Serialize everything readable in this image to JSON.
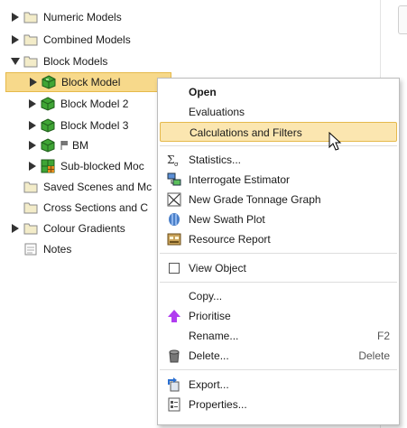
{
  "tree": {
    "items": [
      {
        "label": "Numeric Models",
        "icon": "folder-icon",
        "expanded": false,
        "has_arrow": true
      },
      {
        "label": "Combined Models",
        "icon": "folder-icon",
        "expanded": false,
        "has_arrow": true
      },
      {
        "label": "Block Models",
        "icon": "folder-icon",
        "expanded": true,
        "has_arrow": true
      },
      {
        "label": "Block Model",
        "icon": "block-model-icon",
        "expanded": false,
        "has_arrow": true,
        "selected": true
      },
      {
        "label": "Block Model 2",
        "icon": "block-model-icon",
        "expanded": false,
        "has_arrow": true
      },
      {
        "label": "Block Model 3",
        "icon": "block-model-icon",
        "expanded": false,
        "has_arrow": true
      },
      {
        "label": "BM",
        "icon": "block-model-flag-icon",
        "expanded": false,
        "has_arrow": true
      },
      {
        "label": "Sub-blocked Moc",
        "icon": "sub-blocked-model-icon",
        "expanded": false,
        "has_arrow": true
      },
      {
        "label": "Saved Scenes and Mc",
        "icon": "folder-icon",
        "has_arrow": false
      },
      {
        "label": "Cross Sections and C",
        "icon": "folder-icon",
        "has_arrow": false
      },
      {
        "label": "Colour Gradients",
        "icon": "folder-icon",
        "expanded": false,
        "has_arrow": true
      },
      {
        "label": "Notes",
        "icon": "notes-icon",
        "has_arrow": false
      }
    ]
  },
  "context_menu": {
    "items": [
      {
        "label": "Open",
        "bold": true
      },
      {
        "label": "Evaluations"
      },
      {
        "label": "Calculations and Filters",
        "hover": true
      },
      {
        "label": "Statistics...",
        "icon": "statistics-icon"
      },
      {
        "label": "Interrogate Estimator",
        "icon": "interrogate-icon"
      },
      {
        "label": "New Grade Tonnage Graph",
        "icon": "graph-icon"
      },
      {
        "label": "New Swath Plot",
        "icon": "swath-icon"
      },
      {
        "label": "Resource Report",
        "icon": "report-icon"
      },
      {
        "label": "View Object",
        "checkbox": true
      },
      {
        "label": "Copy..."
      },
      {
        "label": "Prioritise",
        "icon": "up-arrow-icon"
      },
      {
        "label": "Rename...",
        "shortcut": "F2"
      },
      {
        "label": "Delete...",
        "shortcut": "Delete",
        "icon": "delete-icon"
      },
      {
        "label": "Export...",
        "icon": "export-icon"
      },
      {
        "label": "Properties...",
        "icon": "properties-icon"
      }
    ]
  },
  "colors": {
    "selection_bg": "#f7d98b",
    "hover_bg": "#fbe6b0",
    "folder": "#f3e7b3",
    "block_green": "#3fa535",
    "prioritise_purple": "#b03cf0"
  }
}
